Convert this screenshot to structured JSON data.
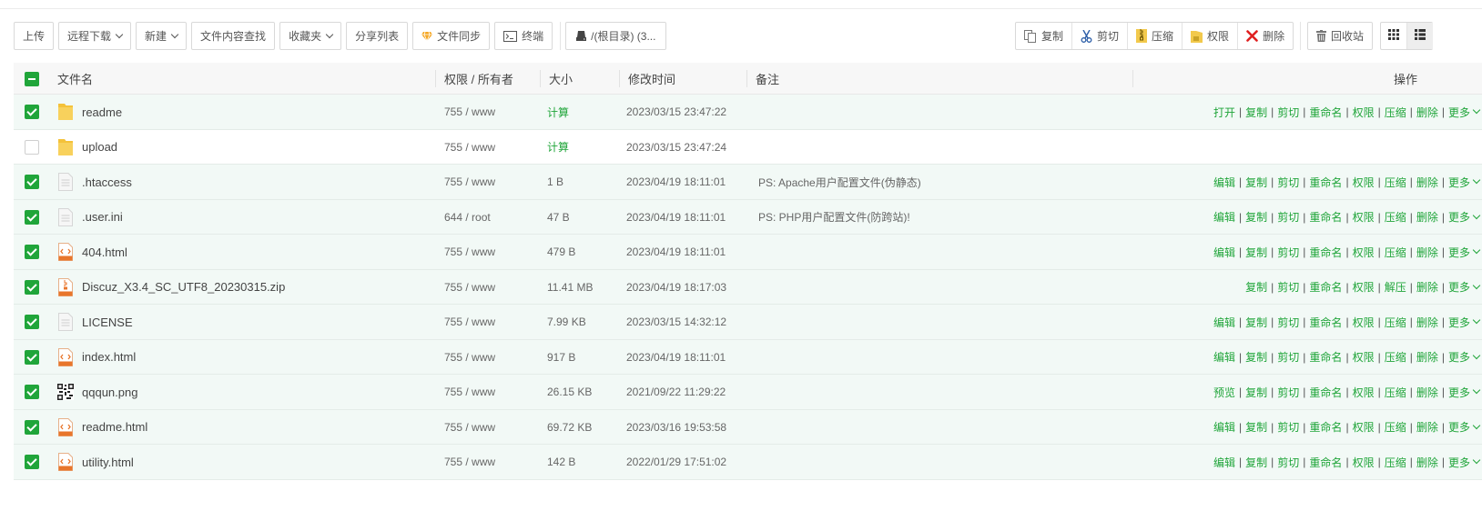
{
  "toolbar": {
    "upload": "上传",
    "remote_download": "远程下载",
    "new": "新建",
    "content_search": "文件内容查找",
    "favorites": "收藏夹",
    "share_list": "分享列表",
    "file_sync": "文件同步",
    "terminal": "终端",
    "path": "/(根目录) (3..."
  },
  "right_toolbar": {
    "copy": "复制",
    "cut": "剪切",
    "compress": "压缩",
    "permission": "权限",
    "delete": "删除",
    "recycle_bin": "回收站"
  },
  "table": {
    "headers": {
      "name": "文件名",
      "perm": "权限 / 所有者",
      "size": "大小",
      "mtime": "修改时间",
      "note": "备注",
      "ops": "操作"
    },
    "rows": [
      {
        "name": "readme",
        "type": "folder",
        "perm": "755 / www",
        "size": "计算",
        "mtime": "2023/03/15 23:47:22",
        "note": "",
        "selected": true,
        "ops": [
          "打开",
          "复制",
          "剪切",
          "重命名",
          "权限",
          "压缩",
          "删除",
          "更多"
        ]
      },
      {
        "name": "upload",
        "type": "folder",
        "perm": "755 / www",
        "size": "计算",
        "mtime": "2023/03/15 23:47:24",
        "note": "",
        "selected": false,
        "ops": []
      },
      {
        "name": ".htaccess",
        "type": "text",
        "perm": "755 / www",
        "size": "1 B",
        "mtime": "2023/04/19 18:11:01",
        "note": "PS: Apache用户配置文件(伪静态)",
        "selected": true,
        "ops": [
          "编辑",
          "复制",
          "剪切",
          "重命名",
          "权限",
          "压缩",
          "删除",
          "更多"
        ]
      },
      {
        "name": ".user.ini",
        "type": "text",
        "perm": "644 / root",
        "size": "47 B",
        "mtime": "2023/04/19 18:11:01",
        "note": "PS: PHP用户配置文件(防跨站)!",
        "selected": true,
        "ops": [
          "编辑",
          "复制",
          "剪切",
          "重命名",
          "权限",
          "压缩",
          "删除",
          "更多"
        ]
      },
      {
        "name": "404.html",
        "type": "html",
        "perm": "755 / www",
        "size": "479 B",
        "mtime": "2023/04/19 18:11:01",
        "note": "",
        "selected": true,
        "ops": [
          "编辑",
          "复制",
          "剪切",
          "重命名",
          "权限",
          "压缩",
          "删除",
          "更多"
        ]
      },
      {
        "name": "Discuz_X3.4_SC_UTF8_20230315.zip",
        "type": "zip",
        "perm": "755 / www",
        "size": "11.41 MB",
        "mtime": "2023/04/19 18:17:03",
        "note": "",
        "selected": true,
        "ops": [
          "复制",
          "剪切",
          "重命名",
          "权限",
          "解压",
          "删除",
          "更多"
        ]
      },
      {
        "name": "LICENSE",
        "type": "text",
        "perm": "755 / www",
        "size": "7.99 KB",
        "mtime": "2023/03/15 14:32:12",
        "note": "",
        "selected": true,
        "ops": [
          "编辑",
          "复制",
          "剪切",
          "重命名",
          "权限",
          "压缩",
          "删除",
          "更多"
        ]
      },
      {
        "name": "index.html",
        "type": "html",
        "perm": "755 / www",
        "size": "917 B",
        "mtime": "2023/04/19 18:11:01",
        "note": "",
        "selected": true,
        "ops": [
          "编辑",
          "复制",
          "剪切",
          "重命名",
          "权限",
          "压缩",
          "删除",
          "更多"
        ]
      },
      {
        "name": "qqqun.png",
        "type": "image",
        "perm": "755 / www",
        "size": "26.15 KB",
        "mtime": "2021/09/22 11:29:22",
        "note": "",
        "selected": true,
        "ops": [
          "预览",
          "复制",
          "剪切",
          "重命名",
          "权限",
          "压缩",
          "删除",
          "更多"
        ]
      },
      {
        "name": "readme.html",
        "type": "html",
        "perm": "755 / www",
        "size": "69.72 KB",
        "mtime": "2023/03/16 19:53:58",
        "note": "",
        "selected": true,
        "ops": [
          "编辑",
          "复制",
          "剪切",
          "重命名",
          "权限",
          "压缩",
          "删除",
          "更多"
        ]
      },
      {
        "name": "utility.html",
        "type": "html",
        "perm": "755 / www",
        "size": "142 B",
        "mtime": "2022/01/29 17:51:02",
        "note": "",
        "selected": true,
        "ops": [
          "编辑",
          "复制",
          "剪切",
          "重命名",
          "权限",
          "压缩",
          "删除",
          "更多"
        ]
      }
    ]
  },
  "colors": {
    "accent": "#20a53a",
    "selected_row": "#f2f9f6",
    "header_bg": "#f7f7f7"
  },
  "icons": {
    "copy": "copy-icon",
    "cut": "scissors-icon",
    "compress": "zip-icon",
    "permission": "lock-icon",
    "delete": "x-icon",
    "recycle": "trash-icon",
    "grid": "grid-view-icon",
    "list": "list-view-icon"
  }
}
